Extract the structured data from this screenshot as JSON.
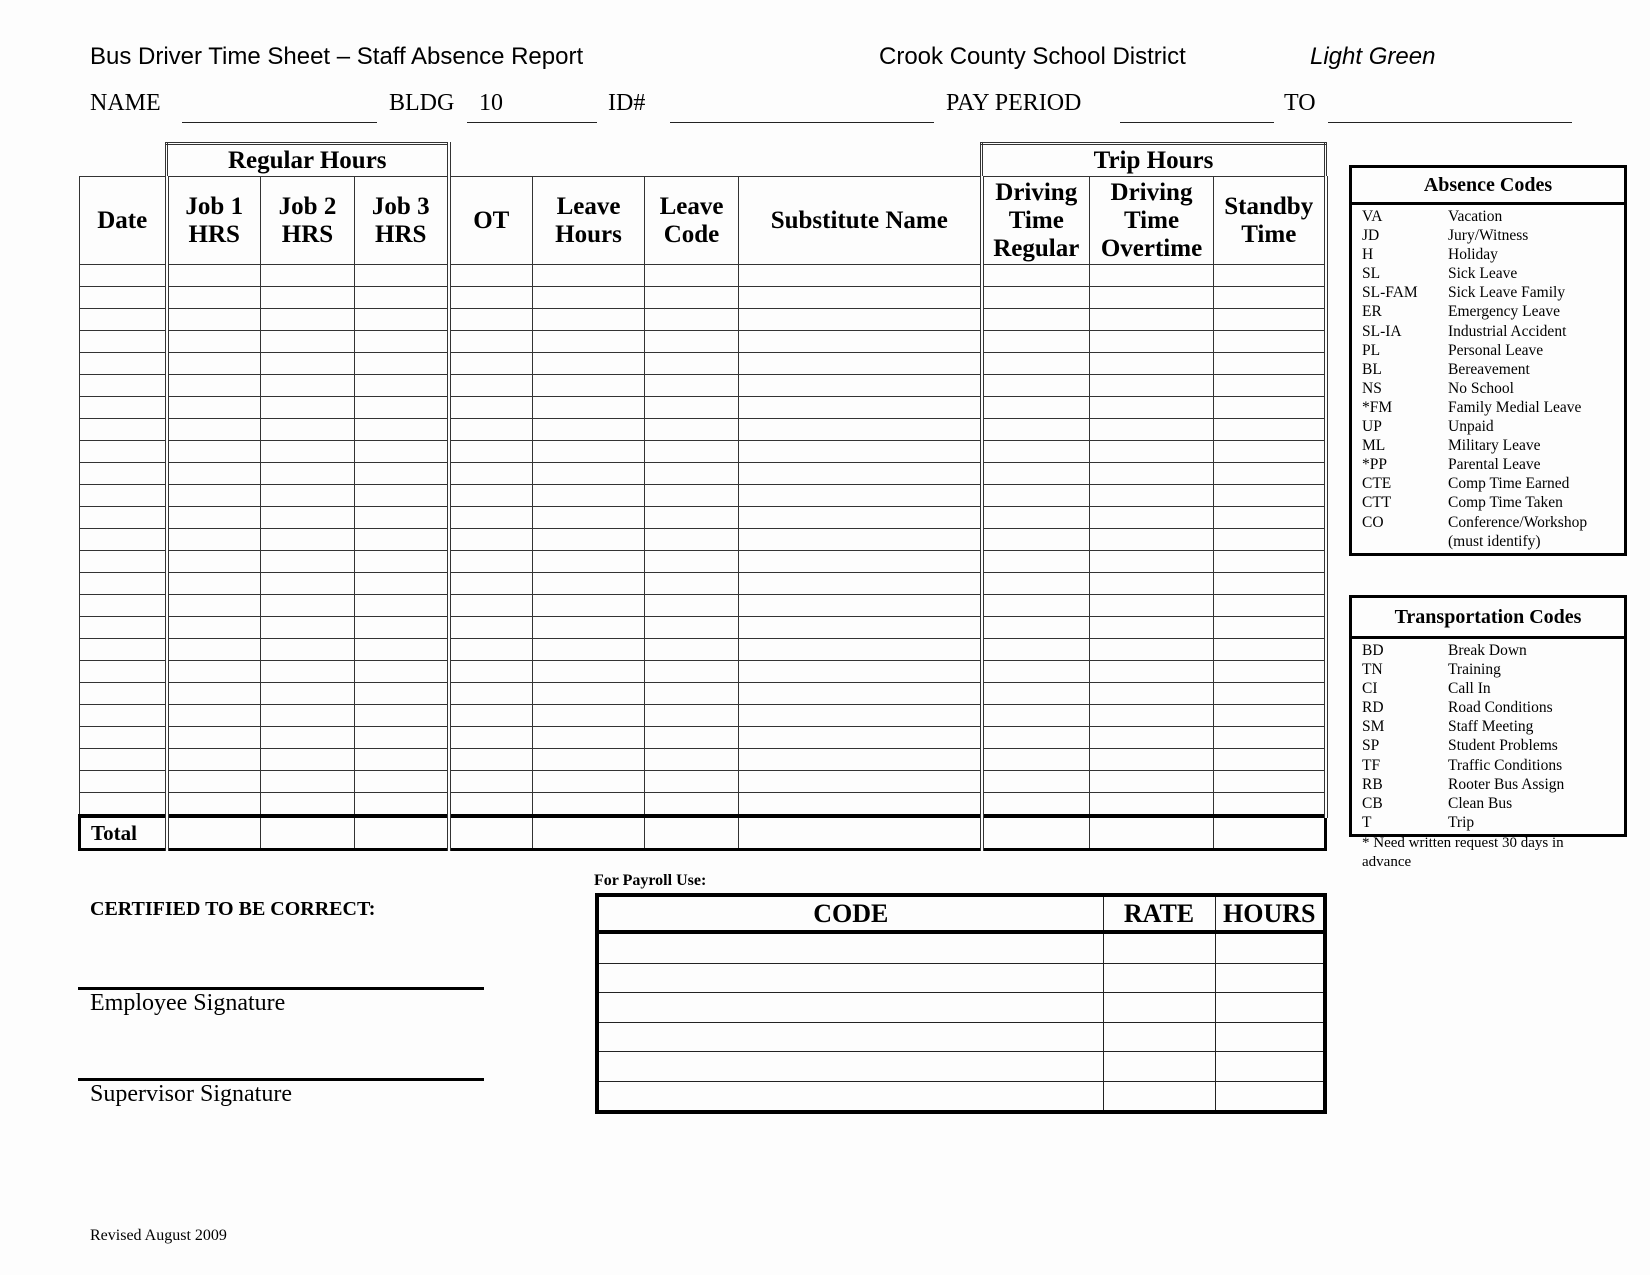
{
  "header": {
    "title": "Bus Driver Time Sheet – Staff Absence Report",
    "district": "Crook County School District",
    "copy_color": "Light Green"
  },
  "fields": {
    "name_label": "NAME",
    "name_value": "",
    "bldg_label": "BLDG",
    "bldg_value": "10",
    "id_label": "ID#",
    "id_value": "",
    "pay_period_label": "PAY PERIOD",
    "pay_period_from": "",
    "to_label": "TO",
    "pay_period_to": ""
  },
  "timesheet": {
    "group_regular": "Regular Hours",
    "group_trip": "Trip Hours",
    "columns": {
      "date": "Date",
      "job1": [
        "Job 1",
        "HRS"
      ],
      "job2": [
        "Job 2",
        "HRS"
      ],
      "job3": [
        "Job 3",
        "HRS"
      ],
      "ot": "OT",
      "leave_hours": [
        "Leave",
        "Hours"
      ],
      "leave_code": [
        "Leave",
        "Code"
      ],
      "substitute": "Substitute Name",
      "drive_reg": [
        "Driving",
        "Time",
        "Regular"
      ],
      "drive_ot": [
        "Driving",
        "Time",
        "Overtime"
      ],
      "standby": [
        "Standby",
        "Time"
      ]
    },
    "body_row_count": 25,
    "total_label": "Total"
  },
  "absence_codes": {
    "title": "Absence Codes",
    "items": [
      {
        "code": "VA",
        "desc": "Vacation"
      },
      {
        "code": "JD",
        "desc": "Jury/Witness"
      },
      {
        "code": "H",
        "desc": "Holiday"
      },
      {
        "code": "SL",
        "desc": "Sick Leave"
      },
      {
        "code": "SL-FAM",
        "desc": "Sick Leave Family"
      },
      {
        "code": "ER",
        "desc": "Emergency Leave"
      },
      {
        "code": "SL-IA",
        "desc": "Industrial Accident"
      },
      {
        "code": "PL",
        "desc": "Personal Leave"
      },
      {
        "code": "BL",
        "desc": "Bereavement"
      },
      {
        "code": "NS",
        "desc": "No School"
      },
      {
        "code": "*FM",
        "desc": "Family Medial Leave"
      },
      {
        "code": "UP",
        "desc": "Unpaid"
      },
      {
        "code": "ML",
        "desc": "Military Leave"
      },
      {
        "code": "*PP",
        "desc": "Parental Leave"
      },
      {
        "code": "CTE",
        "desc": "Comp Time Earned"
      },
      {
        "code": "CTT",
        "desc": "Comp Time Taken"
      },
      {
        "code": "CO",
        "desc": "Conference/Workshop"
      },
      {
        "code": "",
        "desc": "(must identify)"
      }
    ]
  },
  "transportation_codes": {
    "title": "Transportation Codes",
    "items": [
      {
        "code": "BD",
        "desc": "Break Down"
      },
      {
        "code": "TN",
        "desc": "Training"
      },
      {
        "code": "CI",
        "desc": "Call In"
      },
      {
        "code": "RD",
        "desc": "Road Conditions"
      },
      {
        "code": "SM",
        "desc": "Staff Meeting"
      },
      {
        "code": "SP",
        "desc": "Student Problems"
      },
      {
        "code": "TF",
        "desc": "Traffic Conditions"
      },
      {
        "code": "RB",
        "desc": "Rooter Bus Assign"
      },
      {
        "code": "CB",
        "desc": "Clean Bus"
      },
      {
        "code": "T",
        "desc": "Trip"
      }
    ]
  },
  "note": "* Need written request 30 days in advance",
  "certification": {
    "heading": "CERTIFIED TO BE CORRECT:",
    "employee_sig": "Employee Signature",
    "supervisor_sig": "Supervisor Signature"
  },
  "payroll": {
    "label": "For Payroll Use:",
    "headers": [
      "CODE",
      "RATE",
      "HOURS"
    ],
    "row_count": 6
  },
  "footer": {
    "revised": "Revised August 2009"
  }
}
